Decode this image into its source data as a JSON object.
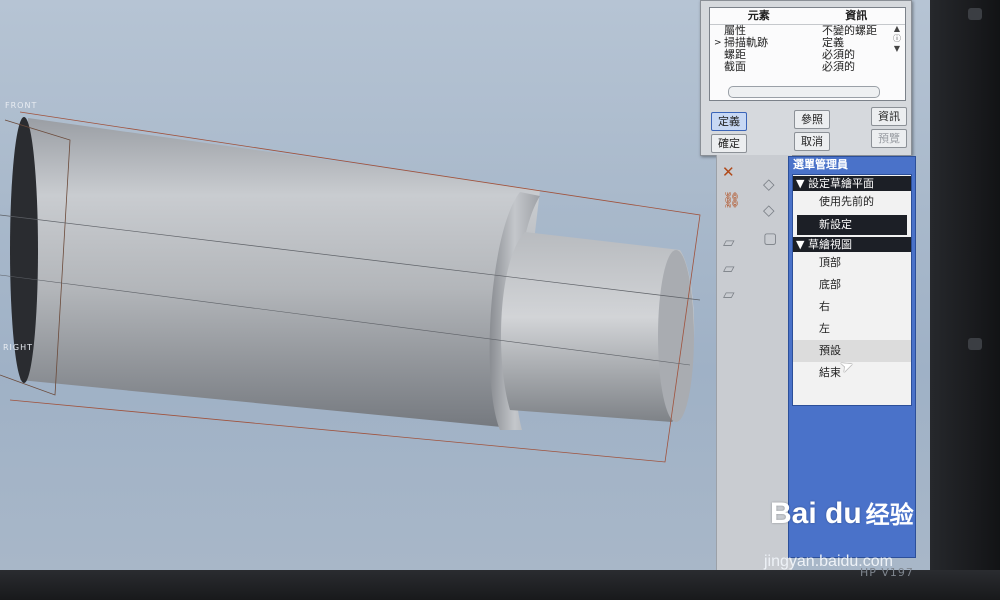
{
  "view_labels": {
    "front": "FRONT",
    "right": "RIGHT"
  },
  "feature_dialog": {
    "table_header": {
      "element": "元素",
      "info": "資訊"
    },
    "rows": [
      {
        "marker": "",
        "element": "屬性",
        "info": "不變的螺距"
      },
      {
        "marker": ">",
        "element": "掃描軌跡",
        "info": "定義"
      },
      {
        "marker": "",
        "element": "螺距",
        "info": "必須的"
      },
      {
        "marker": "",
        "element": "截面",
        "info": "必須的"
      }
    ],
    "buttons": {
      "define": "定義",
      "reference": "參照",
      "info": "資訊",
      "ok": "確定",
      "cancel": "取消",
      "preview": "預覽"
    }
  },
  "menu_manager": {
    "title": "選單管理員",
    "section_sketch_plane": "設定草繪平面",
    "item_use_prev": "使用先前的",
    "item_new_setting": "新設定",
    "section_sketch_view": "草繪視圖",
    "item_top": "頂部",
    "item_bottom": "底部",
    "item_right": "右",
    "item_left": "左",
    "item_default": "預設",
    "item_done": "結束"
  },
  "monitor_label": "HP V197",
  "watermark": {
    "logo": "Bai du",
    "cn": "经验",
    "url": "jingyan.baidu.com"
  },
  "colors": {
    "menu_blue": "#4a72c9",
    "section_dark": "#1c1f26",
    "active_button": "#c7d8f4"
  }
}
